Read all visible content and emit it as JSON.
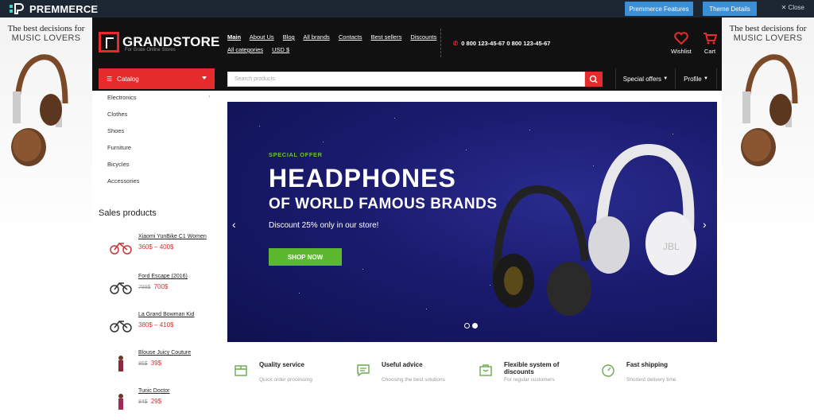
{
  "premmerce": {
    "brand": "PREMMERCE",
    "features_btn": "Premmerce Features",
    "theme_btn": "Theme Details",
    "close": "Close"
  },
  "side_ads": {
    "line1": "The best decisions for",
    "line2": "MUSIC LOVERS"
  },
  "store": {
    "name": "GRANDSTORE",
    "tagline": "For Grate Online Stores"
  },
  "nav": {
    "row1": [
      "Main",
      "About Us",
      "Blog",
      "All brands",
      "Contacts",
      "Best sellers",
      "Discounts"
    ],
    "row2": [
      "All categories",
      "USD $"
    ]
  },
  "phone": "0 800 123-45-67 0 800 123-45-67",
  "header_icons": {
    "wishlist": "Wishlist",
    "cart": "Cart"
  },
  "catalog_label": "Catalog",
  "search_placeholder": "Search products",
  "special_offers": "Special offers",
  "profile": "Profile",
  "categories": [
    "Electronics",
    "Clothes",
    "Shoes",
    "Furniture",
    "Bicycles",
    "Accessories"
  ],
  "sales_title": "Sales products",
  "products": [
    {
      "name": "Xiaomi YunBike C1 Women",
      "old": "",
      "price": "360$ – 400$"
    },
    {
      "name": "Ford Escape (2016)",
      "old": "799$",
      "price": "700$"
    },
    {
      "name": "La Grand Bowman Kid",
      "old": "",
      "price": "380$ – 410$"
    },
    {
      "name": "Blouse Juicy Couture",
      "old": "86$",
      "price": "39$"
    },
    {
      "name": "Tunic Doctor",
      "old": "84$",
      "price": "29$"
    }
  ],
  "banner": {
    "kicker": "SPECIAL OFFER",
    "title": "HEADPHONES",
    "subtitle": "OF WORLD FAMOUS BRANDS",
    "discount": "Discount 25% only in our store!",
    "cta": "SHOP NOW",
    "brand_mark": "JBL"
  },
  "features": [
    {
      "title": "Quality service",
      "sub": "Quick order processing",
      "icon": "box-icon"
    },
    {
      "title": "Useful advice",
      "sub": "Choosing the best solutions",
      "icon": "chat-icon"
    },
    {
      "title": "Flexible system of discounts",
      "sub": "For regular customers",
      "icon": "bag-icon"
    },
    {
      "title": "Fast shipping",
      "sub": "Shortest delivery time",
      "icon": "speed-icon"
    }
  ],
  "colors": {
    "accent": "#e52b2b",
    "green": "#5bb82f",
    "topbar": "#1c2733",
    "button_blue": "#3a8fd6"
  }
}
